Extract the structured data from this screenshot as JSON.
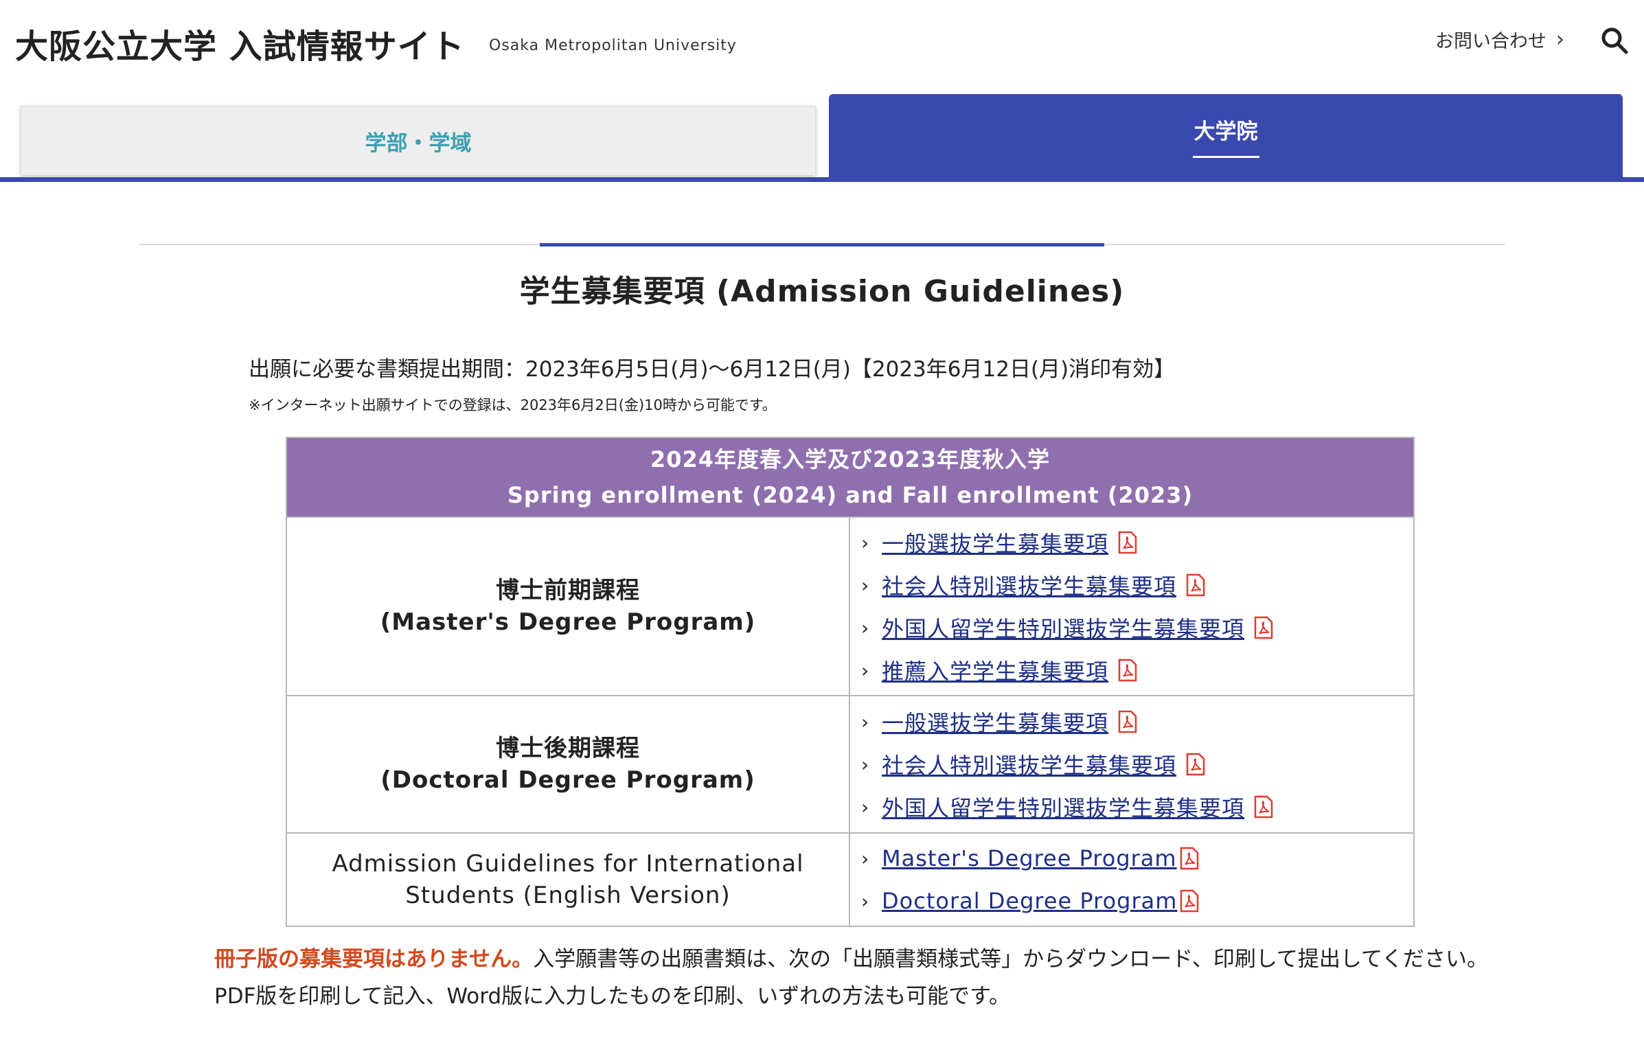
{
  "header": {
    "site_title": "大阪公立大学 入試情報サイト",
    "site_subtitle": "Osaka Metropolitan University",
    "contact_label": "お問い合わせ",
    "search_icon": "search-icon"
  },
  "tabs": [
    {
      "label": "学部・学域",
      "active": false
    },
    {
      "label": "大学院",
      "active": true
    }
  ],
  "colors": {
    "accent": "#3a49ae",
    "table_header": "#8f6fad",
    "link": "#1e2f86",
    "pdf": "#e03a2f",
    "notice": "#d2491e"
  },
  "main": {
    "title": "学生募集要項 (Admission Guidelines)",
    "period": "出願に必要な書類提出期間：2023年6月5日(月)〜6月12日(月)【2023年6月12日(月)消印有効】",
    "note": "※インターネット出願サイトでの登録は、2023年6月2日(金)10時から可能です。",
    "table": {
      "header_line1": "2024年度春入学及び2023年度秋入学",
      "header_line2": "Spring enrollment (2024) and Fall enrollment (2023)",
      "rows": [
        {
          "program_line1": "博士前期課程",
          "program_line2": "(Master's Degree Program)",
          "links": [
            "一般選抜学生募集要項",
            "社会人特別選抜学生募集要項",
            "外国人留学生特別選抜学生募集要項",
            "推薦入学学生募集要項"
          ]
        },
        {
          "program_line1": "博士後期課程",
          "program_line2": "(Doctoral Degree Program)",
          "links": [
            "一般選抜学生募集要項",
            "社会人特別選抜学生募集要項",
            "外国人留学生特別選抜学生募集要項"
          ]
        },
        {
          "program_line1": "Admission Guidelines for International",
          "program_line2": "Students (English Version)",
          "links": [
            "Master's Degree Program",
            "Doctoral Degree Program"
          ]
        }
      ]
    },
    "footer_notice": "冊子版の募集要項はありません。",
    "footer_text": "入学願書等の出願書類は、次の「出願書類様式等」からダウンロード、印刷して提出してください。PDF版を印刷して記入、Word版に入力したものを印刷、いずれの方法も可能です。"
  }
}
